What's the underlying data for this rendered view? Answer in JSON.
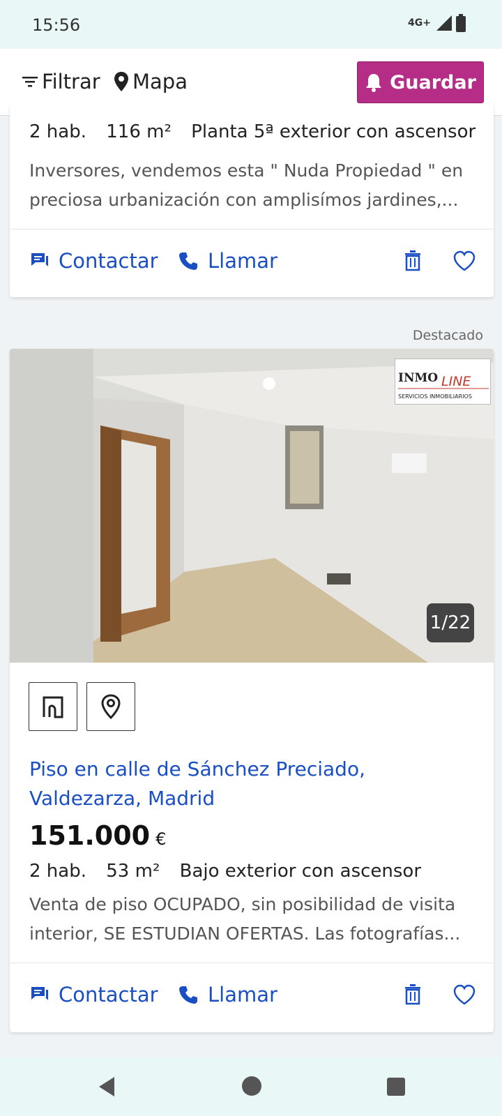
{
  "status_bar": {
    "time": "15:56",
    "network": "4G+"
  },
  "topbar": {
    "filter_label": "Filtrar",
    "map_label": "Mapa",
    "save_label": "Guardar"
  },
  "listings": [
    {
      "features": [
        "2 hab.",
        "116 m²",
        "Planta 5ª exterior con ascensor"
      ],
      "description_lines": [
        "Inversores, vendemos esta \" Nuda Propiedad \" en",
        "preciosa urbanización con amplisímos jardines,..."
      ],
      "contact_label": "Contactar",
      "call_label": "Llamar"
    },
    {
      "featured_label": "Destacado",
      "agency_logo_text": "INMO",
      "agency_logo_text2": "LINE",
      "agency_logo_sub": "SERVICIOS INMOBILIARIOS",
      "photo_counter": "1/22",
      "title": "Piso en calle de Sánchez Preciado, Valdezarza, Madrid",
      "price": "151.000",
      "currency": "€",
      "features": [
        "2 hab.",
        "53 m²",
        "Bajo exterior con ascensor"
      ],
      "description_lines": [
        "Venta de piso OCUPADO, sin posibilidad de visita",
        "interior, SE ESTUDIAN OFERTAS. Las fotografías..."
      ],
      "contact_label": "Contactar",
      "call_label": "Llamar"
    }
  ],
  "colors": {
    "accent": "#b52d86",
    "link": "#1a4fc4",
    "status_bg": "#e9f7f6"
  }
}
